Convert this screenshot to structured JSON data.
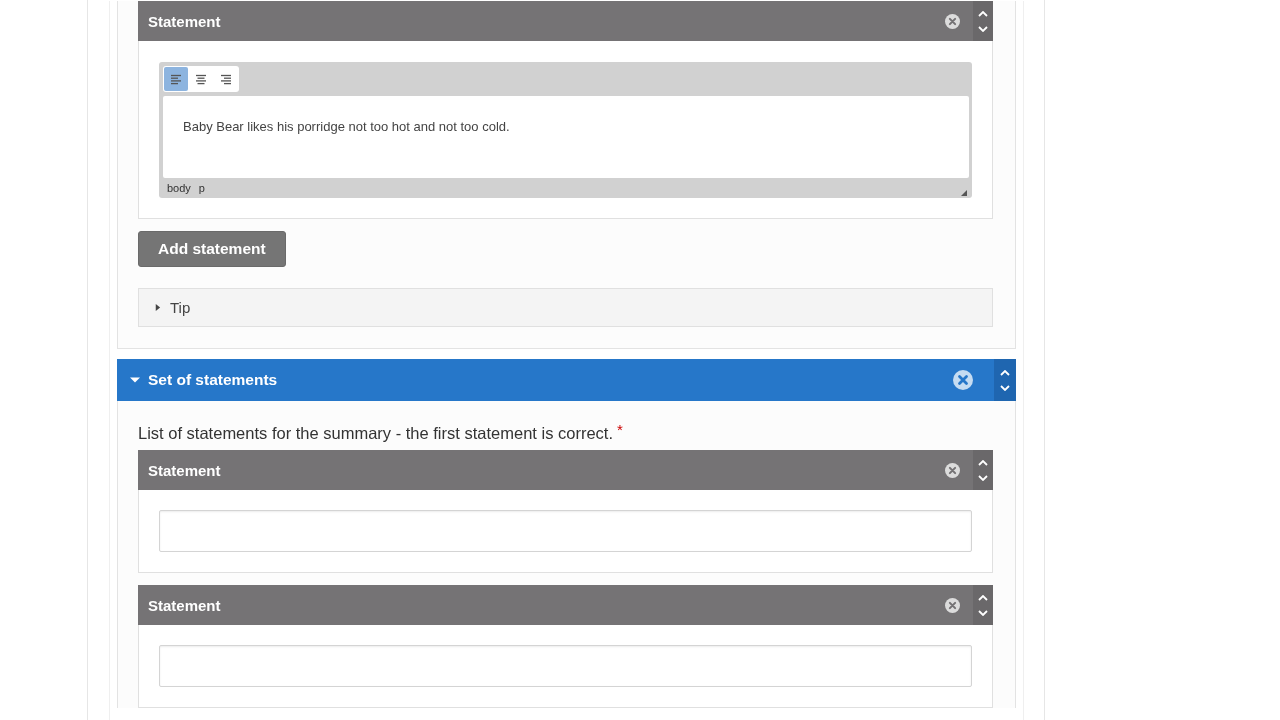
{
  "content_section": {
    "statements": [
      {
        "title": "Statement",
        "kind": "editor",
        "toolbar": [
          {
            "kind": "align-left",
            "selected": true
          },
          {
            "kind": "align-center",
            "selected": false
          },
          {
            "kind": "align-right",
            "selected": false
          }
        ],
        "text": "Baby Bear likes his porridge not too hot and not too cold.",
        "element_path": [
          "body",
          "p"
        ]
      }
    ],
    "add_button": "Add statement",
    "tip": {
      "label": "Tip",
      "expanded": false
    }
  },
  "statement_set": {
    "title": "Set of statements",
    "expanded": true,
    "description": "List of statements for the summary - the first statement is correct.",
    "required_mark": "*",
    "statements": [
      {
        "title": "Statement",
        "kind": "input"
      },
      {
        "title": "Statement",
        "kind": "input"
      }
    ]
  }
}
